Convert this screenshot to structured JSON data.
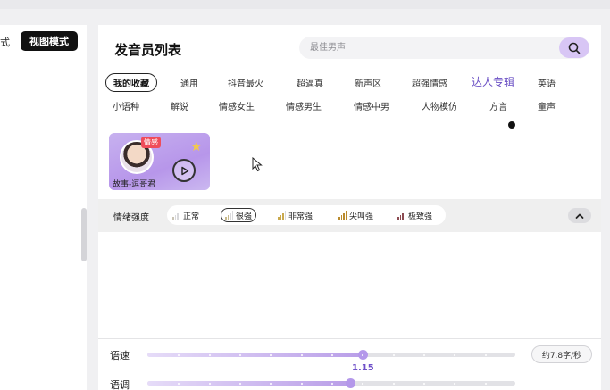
{
  "left_panel": {
    "partial_mode_label": "式",
    "view_mode_button": "视图模式"
  },
  "main": {
    "title": "发音员列表",
    "search": {
      "placeholder": "最佳男声"
    },
    "tags_row1": [
      "我的收藏",
      "通用",
      "抖音最火",
      "超逼真",
      "新声区",
      "超强情感",
      "达人专辑",
      "英语"
    ],
    "tags_row2": [
      "小语种",
      "解说",
      "情感女生",
      "情感男生",
      "情感中男",
      "人物模仿",
      "方言",
      "童声"
    ],
    "active_tag": "我的收藏",
    "voice_card": {
      "badge": "情感",
      "name": "故事-逗哥君"
    },
    "emotion": {
      "label": "情绪强度",
      "options": [
        "正常",
        "很强",
        "非常强",
        "尖叫强",
        "极致强"
      ],
      "active_index": 1,
      "colors": [
        "#c9c3b4",
        "#c7b98a",
        "#c9a94d",
        "#b98b2e",
        "#8c4b52"
      ]
    },
    "speed": {
      "label": "语速",
      "value": "1.15",
      "position": 0.585,
      "rate": "约7.8字/秒"
    },
    "tone": {
      "label": "语调",
      "position": 0.55
    }
  }
}
